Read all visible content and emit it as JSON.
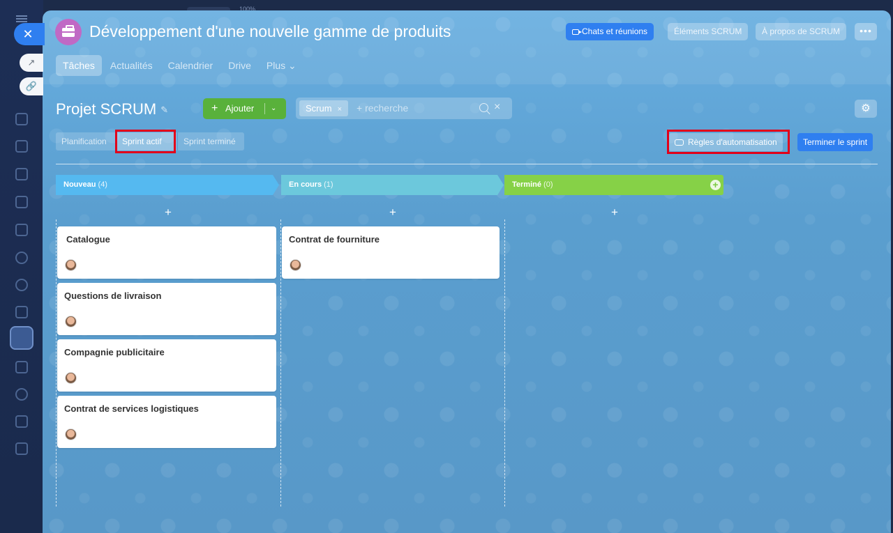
{
  "top_bar": {
    "zoom": "100%"
  },
  "slider_controls": {
    "close_glyph": "✕",
    "open_glyph": "↗",
    "link_glyph": "🔗"
  },
  "header": {
    "title": "Développement d'une nouvelle gamme de produits",
    "buttons": {
      "chats": "Chats et réunions",
      "scrum_items": "Éléments SCRUM",
      "about": "À propos de SCRUM",
      "more": "•••"
    },
    "tabs": [
      {
        "label": "Tâches",
        "active": true
      },
      {
        "label": "Actualités"
      },
      {
        "label": "Calendrier"
      },
      {
        "label": "Drive"
      },
      {
        "label": "Plus ⌄"
      }
    ]
  },
  "toolbar": {
    "project_title": "Projet SCRUM",
    "pin_glyph": "✎",
    "add": {
      "plus": "+",
      "label": "Ajouter",
      "caret": "⌄"
    },
    "search": {
      "chip": "Scrum",
      "chip_close": "×",
      "placeholder": "+ recherche",
      "clear": "×"
    },
    "settings_glyph": "⚙"
  },
  "sprint_tabs": [
    "Planification",
    "Sprint actif",
    "Sprint terminé"
  ],
  "actions": {
    "rules": "Règles d'automatisation",
    "finish": "Terminer le sprint"
  },
  "columns": [
    {
      "name": "Nouveau",
      "count": "(4)",
      "color": "#55b9f0"
    },
    {
      "name": "En cours",
      "count": "(1)",
      "color": "#6cc8dc"
    },
    {
      "name": "Terminé",
      "count": "(0)",
      "color": "#86d147"
    }
  ],
  "column_add_glyph": "+",
  "cards": {
    "nouveau": [
      "Catalogue",
      "Questions de livraison",
      "Compagnie publicitaire",
      "Contrat de services logistiques"
    ],
    "en_cours": [
      "Contrat de fourniture"
    ]
  }
}
